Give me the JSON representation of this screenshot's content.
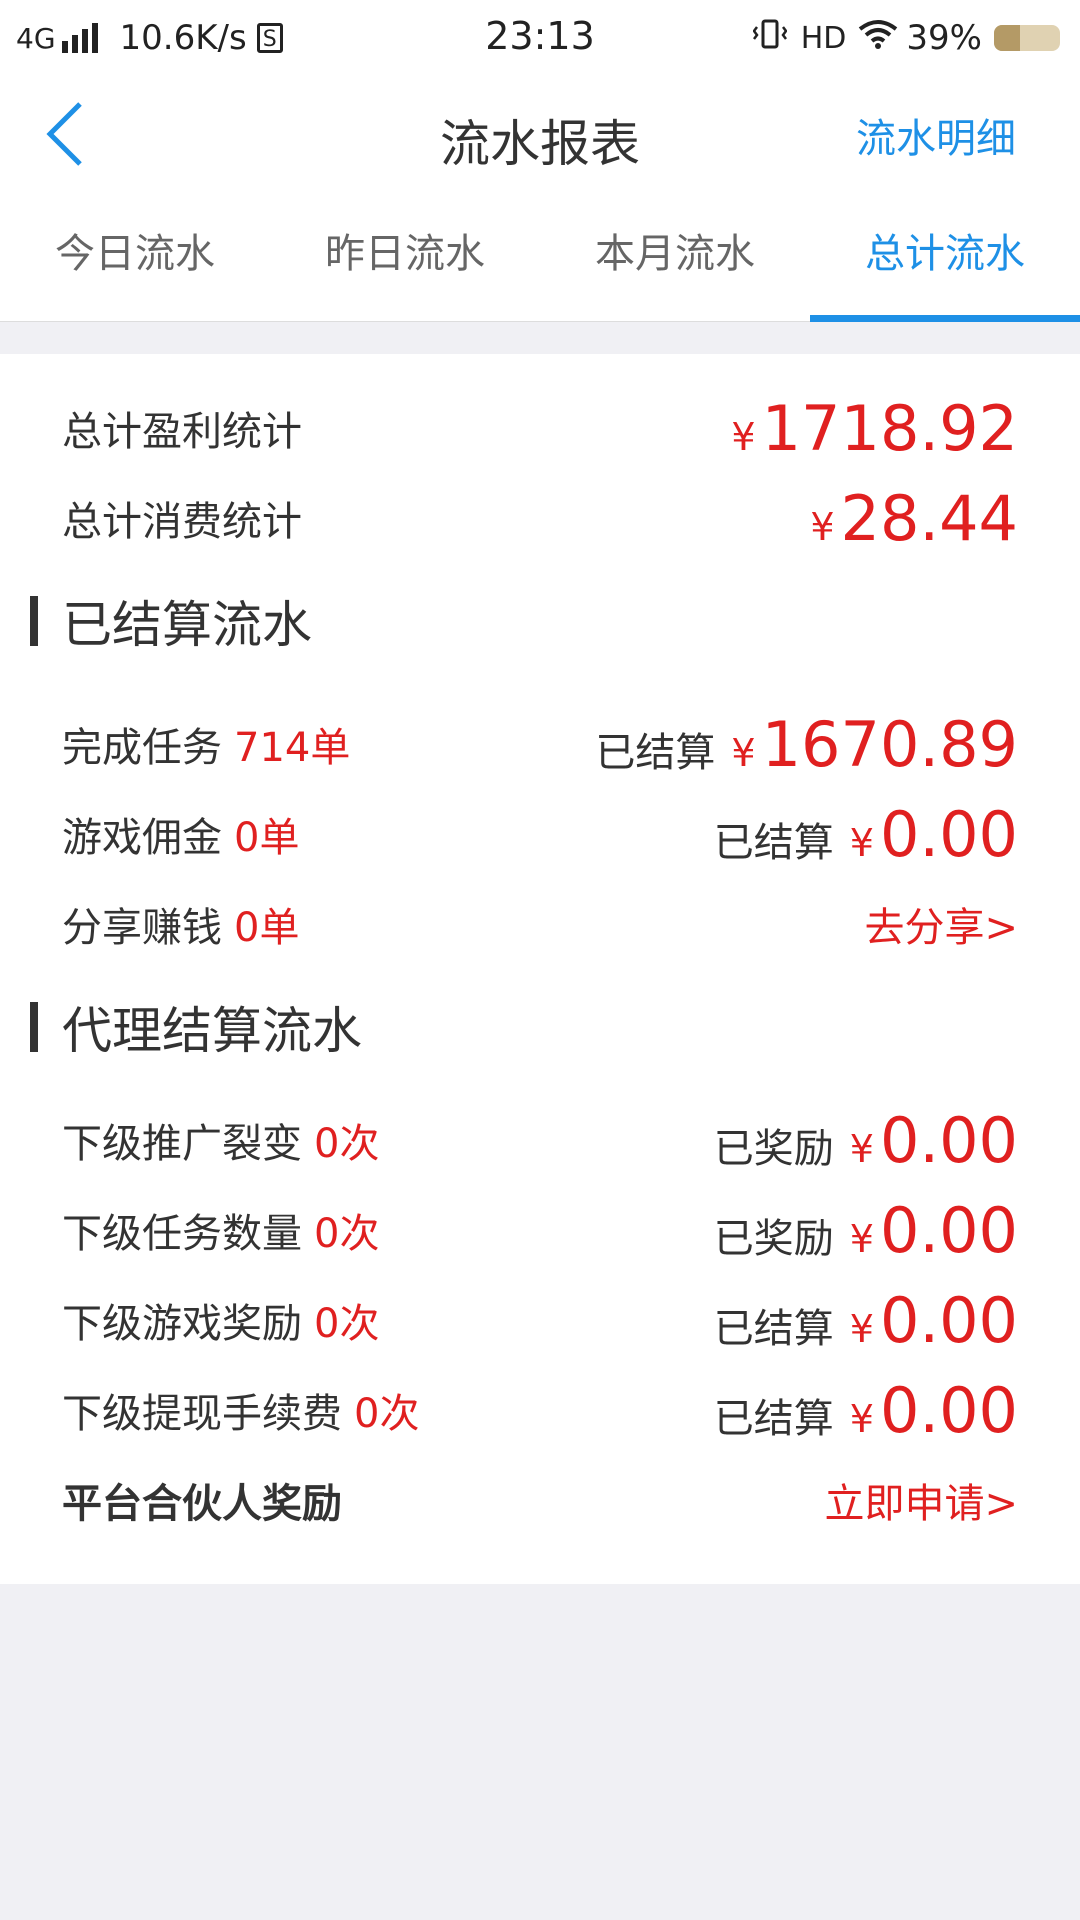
{
  "status_bar": {
    "network": "4G",
    "speed": "10.6K/s",
    "s_icon": "S",
    "time": "23:13",
    "hd": "HD",
    "battery": "39%",
    "battery_level": 0.39
  },
  "nav": {
    "title": "流水报表",
    "right_link": "流水明细",
    "back_icon": "chevron-left-icon"
  },
  "tabs": [
    {
      "label": "今日流水",
      "active": false
    },
    {
      "label": "昨日流水",
      "active": false
    },
    {
      "label": "本月流水",
      "active": false
    },
    {
      "label": "总计流水",
      "active": true
    }
  ],
  "summary": {
    "profit_label": "总计盈利统计",
    "profit_yen": "¥",
    "profit_amount": "1718.92",
    "consume_label": "总计消费统计",
    "consume_yen": "¥",
    "consume_amount": "28.44"
  },
  "settled": {
    "title": "已结算流水",
    "rows": [
      {
        "label": "完成任务",
        "count": "714单",
        "status": "已结算",
        "yen": "¥",
        "amount": "1670.89"
      },
      {
        "label": "游戏佣金",
        "count": "0单",
        "status": "已结算",
        "yen": "¥",
        "amount": "0.00"
      },
      {
        "label": "分享赚钱",
        "count": "0单",
        "link": "去分享>"
      }
    ]
  },
  "agent": {
    "title": "代理结算流水",
    "rows": [
      {
        "label": "下级推广裂变",
        "count": "0次",
        "status": "已奖励",
        "yen": "¥",
        "amount": "0.00"
      },
      {
        "label": "下级任务数量",
        "count": "0次",
        "status": "已奖励",
        "yen": "¥",
        "amount": "0.00"
      },
      {
        "label": "下级游戏奖励",
        "count": "0次",
        "status": "已结算",
        "yen": "¥",
        "amount": "0.00"
      },
      {
        "label": "下级提现手续费",
        "count": "0次",
        "status": "已结算",
        "yen": "¥",
        "amount": "0.00"
      },
      {
        "label": "平台合伙人奖励",
        "link": "立即申请>"
      }
    ]
  },
  "colors": {
    "accent_blue": "#1e90e6",
    "money_red": "#e02020",
    "page_bg": "#f0f0f4"
  }
}
